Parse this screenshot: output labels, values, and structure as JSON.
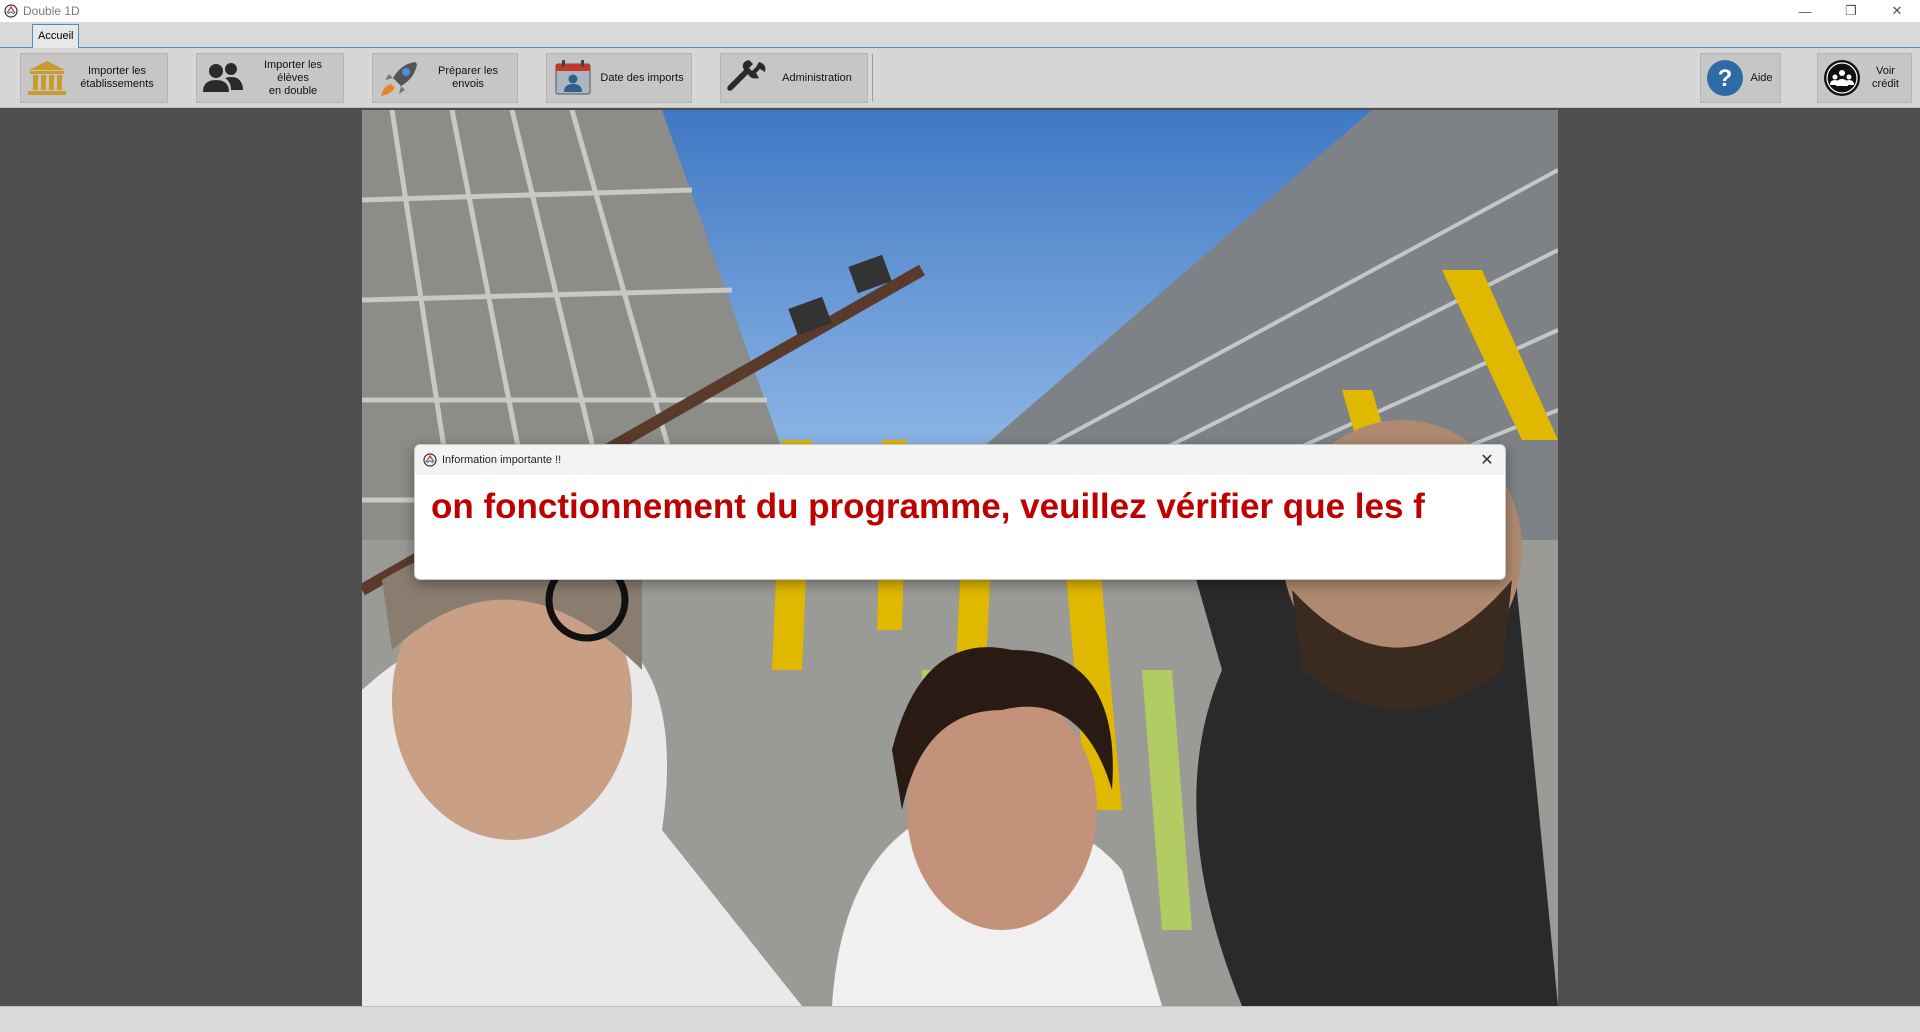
{
  "window": {
    "title": "Double 1D",
    "controls": {
      "minimize": "—",
      "restore": "❐",
      "close": "✕"
    }
  },
  "ribbon": {
    "tabs": [
      {
        "label": "Accueil",
        "active": true
      }
    ],
    "buttons": [
      {
        "id": "import-etab",
        "label": "Importer les\nétablissements",
        "icon": "bank-icon"
      },
      {
        "id": "import-eleves",
        "label": "Importer les élèves\nen double",
        "icon": "users-icon"
      },
      {
        "id": "preparer",
        "label": "Préparer les envois",
        "icon": "rocket-icon"
      },
      {
        "id": "date-imports",
        "label": "Date des imports",
        "icon": "calendar-user-icon"
      },
      {
        "id": "admin",
        "label": "Administration",
        "icon": "wrench-icon"
      },
      {
        "id": "aide",
        "label": "Aide",
        "icon": "help-icon"
      },
      {
        "id": "credit",
        "label": "Voir crédit",
        "icon": "team-icon"
      }
    ]
  },
  "content": {
    "background_photo": "group-selfie-photo"
  },
  "dialog": {
    "title": "Information importante !!",
    "message": "on fonctionnement du programme, veuillez vérifier que les f",
    "close_symbol": "✕"
  },
  "colors": {
    "message": "#bd0000",
    "icon_gold": "#c99a2e",
    "help_blue": "#2e6aa6"
  }
}
